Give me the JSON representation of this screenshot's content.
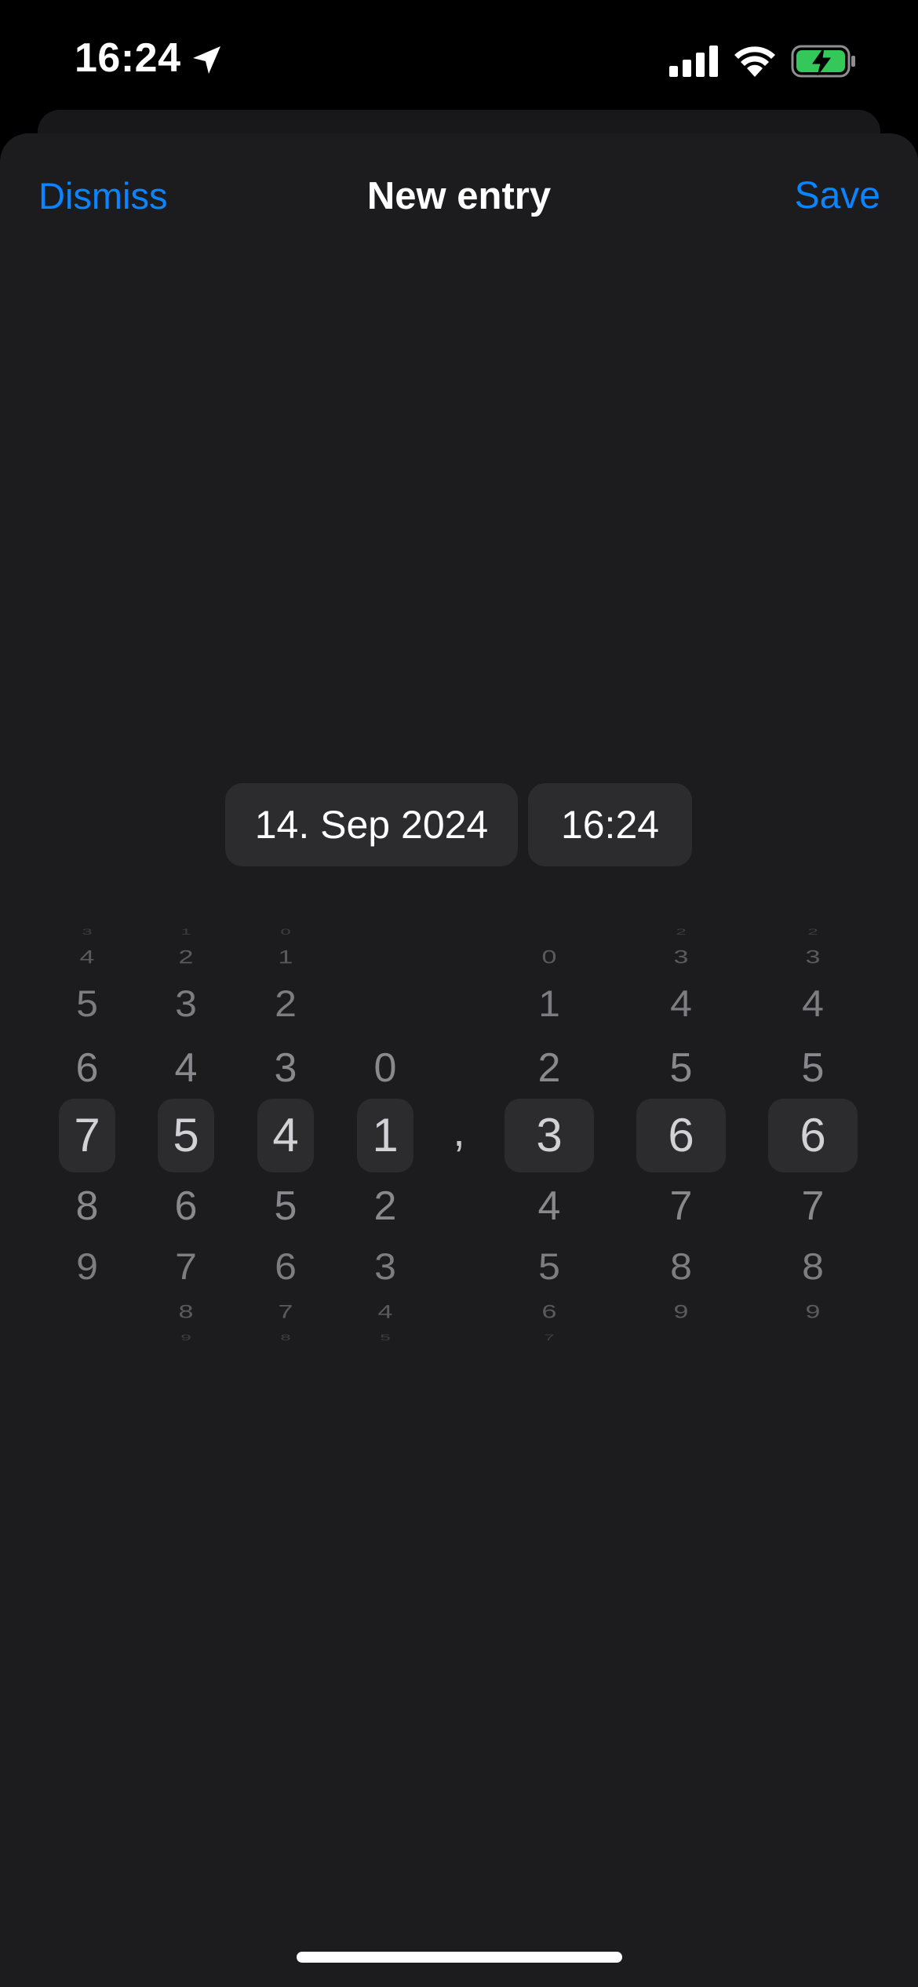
{
  "status_bar": {
    "time": "16:24",
    "icons": [
      "location-arrow-icon",
      "cellular-signal-icon",
      "wifi-icon",
      "battery-charging-icon"
    ]
  },
  "nav": {
    "dismiss_label": "Dismiss",
    "title": "New entry",
    "save_label": "Save"
  },
  "datetime": {
    "date": "14. Sep 2024",
    "time": "16:24"
  },
  "number_picker": {
    "separator": ",",
    "wheels": [
      {
        "above": [
          "3",
          "4",
          "5",
          "6"
        ],
        "selected": "7",
        "below": [
          "8",
          "9"
        ]
      },
      {
        "above": [
          "1",
          "2",
          "3",
          "4"
        ],
        "selected": "5",
        "below": [
          "6",
          "7",
          "8",
          "9"
        ]
      },
      {
        "above": [
          "0",
          "1",
          "2",
          "3"
        ],
        "selected": "4",
        "below": [
          "5",
          "6",
          "7",
          "8"
        ]
      },
      {
        "above": [
          "0"
        ],
        "selected": "1",
        "below": [
          "2",
          "3",
          "4",
          "5"
        ]
      },
      {
        "above": [
          "0",
          "1",
          "2"
        ],
        "selected": "3",
        "below": [
          "4",
          "5",
          "6",
          "7"
        ]
      },
      {
        "above": [
          "2",
          "3",
          "4",
          "5"
        ],
        "selected": "6",
        "below": [
          "7",
          "8",
          "9"
        ]
      },
      {
        "above": [
          "2",
          "3",
          "4",
          "5"
        ],
        "selected": "6",
        "below": [
          "7",
          "8",
          "9"
        ]
      }
    ]
  },
  "colors": {
    "accent": "#0a84ff",
    "sheet_background": "#1c1c1e",
    "pill_background": "#2c2c2e",
    "battery_fill": "#34c759"
  }
}
